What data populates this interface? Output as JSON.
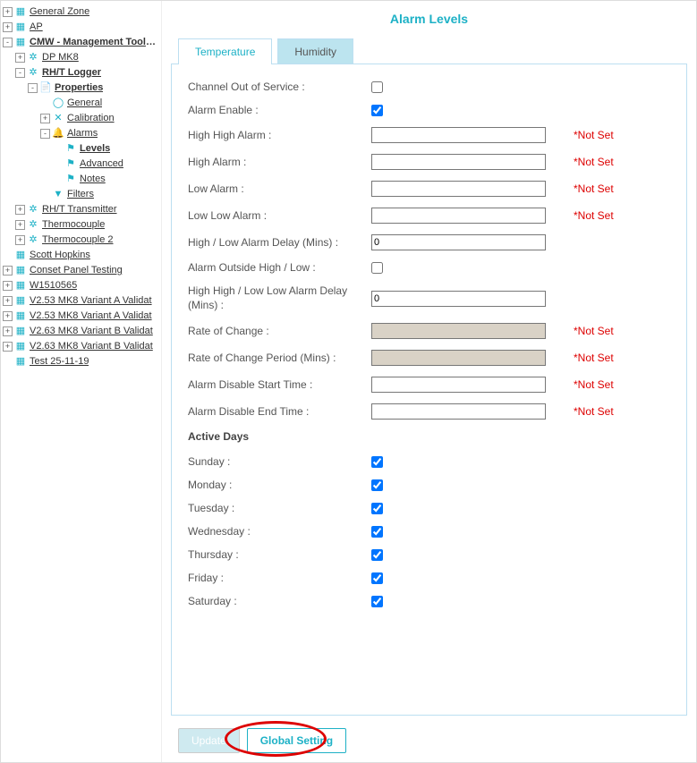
{
  "title": "Alarm Levels",
  "tree": {
    "items": [
      {
        "indent": 0,
        "exp": "+",
        "icon": "grid",
        "label": "General Zone",
        "bold": false
      },
      {
        "indent": 0,
        "exp": "+",
        "icon": "grid",
        "label": "AP",
        "bold": false
      },
      {
        "indent": 0,
        "exp": "-",
        "icon": "grid",
        "label": "CMW - Management Tools Te",
        "bold": true
      },
      {
        "indent": 1,
        "exp": "+",
        "icon": "fan",
        "label": "DP MK8",
        "bold": false
      },
      {
        "indent": 1,
        "exp": "-",
        "icon": "fan",
        "label": "RH/T Logger",
        "bold": true
      },
      {
        "indent": 2,
        "exp": "-",
        "icon": "doc",
        "label": "Properties",
        "bold": true
      },
      {
        "indent": 3,
        "exp": " ",
        "icon": "circle",
        "label": "General",
        "bold": false
      },
      {
        "indent": 3,
        "exp": "+",
        "icon": "x",
        "label": "Calibration",
        "bold": false
      },
      {
        "indent": 3,
        "exp": "-",
        "icon": "bell",
        "label": "Alarms",
        "bold": false
      },
      {
        "indent": 4,
        "exp": " ",
        "icon": "flag",
        "label": "Levels",
        "bold": true
      },
      {
        "indent": 4,
        "exp": " ",
        "icon": "flag",
        "label": "Advanced",
        "bold": false
      },
      {
        "indent": 4,
        "exp": " ",
        "icon": "flag",
        "label": "Notes",
        "bold": false
      },
      {
        "indent": 3,
        "exp": " ",
        "icon": "filter",
        "label": "Filters",
        "bold": false
      },
      {
        "indent": 1,
        "exp": "+",
        "icon": "fan",
        "label": "RH/T Transmitter",
        "bold": false
      },
      {
        "indent": 1,
        "exp": "+",
        "icon": "fan",
        "label": "Thermocouple",
        "bold": false
      },
      {
        "indent": 1,
        "exp": "+",
        "icon": "fan",
        "label": "Thermocouple 2",
        "bold": false
      },
      {
        "indent": 0,
        "exp": " ",
        "icon": "grid",
        "label": "Scott Hopkins",
        "bold": false
      },
      {
        "indent": 0,
        "exp": "+",
        "icon": "grid",
        "label": "Conset Panel Testing",
        "bold": false
      },
      {
        "indent": 0,
        "exp": "+",
        "icon": "grid",
        "label": "W1510565",
        "bold": false
      },
      {
        "indent": 0,
        "exp": "+",
        "icon": "grid",
        "label": "V2.53 MK8 Variant A Validat",
        "bold": false
      },
      {
        "indent": 0,
        "exp": "+",
        "icon": "grid",
        "label": "V2.53 MK8 Variant A Validat",
        "bold": false
      },
      {
        "indent": 0,
        "exp": "+",
        "icon": "grid",
        "label": "V2.63 MK8 Variant B Validat",
        "bold": false
      },
      {
        "indent": 0,
        "exp": "+",
        "icon": "grid",
        "label": "V2.63 MK8 Variant B Validat",
        "bold": false
      },
      {
        "indent": 0,
        "exp": " ",
        "icon": "grid",
        "label": "Test 25-11-19",
        "bold": false
      }
    ]
  },
  "tabs": {
    "t1": "Temperature",
    "t2": "Humidity"
  },
  "form": {
    "out_of_service": {
      "label": "Channel Out of Service :",
      "checked": false
    },
    "alarm_enable": {
      "label": "Alarm Enable :",
      "checked": true
    },
    "hh_alarm": {
      "label": "High High Alarm :",
      "value": "",
      "status": "*Not Set"
    },
    "h_alarm": {
      "label": "High Alarm :",
      "value": "",
      "status": "*Not Set"
    },
    "l_alarm": {
      "label": "Low Alarm :",
      "value": "",
      "status": "*Not Set"
    },
    "ll_alarm": {
      "label": "Low Low Alarm :",
      "value": "",
      "status": "*Not Set"
    },
    "hl_delay": {
      "label": "High / Low Alarm Delay (Mins) :",
      "value": "0"
    },
    "outside_hl": {
      "label": "Alarm Outside High / Low :",
      "checked": false
    },
    "hhll_delay": {
      "label": "High High / Low Low Alarm Delay (Mins) :",
      "value": "0"
    },
    "roc": {
      "label": "Rate of Change :",
      "value": "",
      "status": "*Not Set",
      "disabled": true
    },
    "roc_period": {
      "label": "Rate of Change Period (Mins) :",
      "value": "",
      "status": "*Not Set",
      "disabled": true
    },
    "dis_start": {
      "label": "Alarm Disable Start Time :",
      "value": "",
      "status": "*Not Set"
    },
    "dis_end": {
      "label": "Alarm Disable End Time :",
      "value": "",
      "status": "*Not Set"
    },
    "active_days_header": "Active Days",
    "days": {
      "sun": {
        "label": "Sunday :",
        "checked": true
      },
      "mon": {
        "label": "Monday :",
        "checked": true
      },
      "tue": {
        "label": "Tuesday :",
        "checked": true
      },
      "wed": {
        "label": "Wednesday :",
        "checked": true
      },
      "thu": {
        "label": "Thursday :",
        "checked": true
      },
      "fri": {
        "label": "Friday :",
        "checked": true
      },
      "sat": {
        "label": "Saturday :",
        "checked": true
      }
    }
  },
  "buttons": {
    "update": "Update",
    "global": "Global Setting"
  },
  "icons": {
    "grid": "▦",
    "fan": "✲",
    "doc": "📄",
    "bell": "🔔",
    "flag": "⚑",
    "filter": "▼",
    "x": "✕",
    "circle": "◯"
  }
}
